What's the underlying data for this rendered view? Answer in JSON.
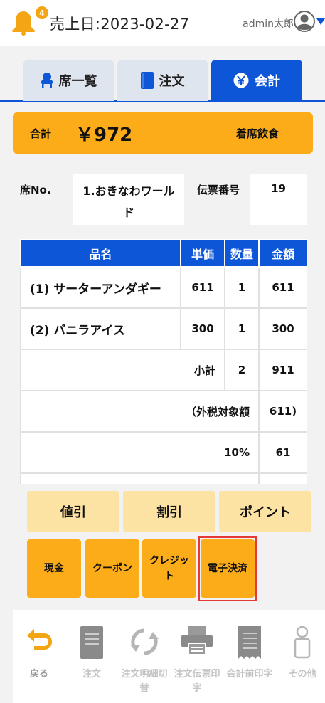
{
  "header": {
    "notification_count": "4",
    "sales_date": "売上日:2023-02-27",
    "user_name": "admin太郎"
  },
  "tabs": [
    {
      "label": "席一覧",
      "icon": "chair-icon",
      "active": false
    },
    {
      "label": "注文",
      "icon": "book-icon",
      "active": false
    },
    {
      "label": "会計",
      "icon": "yen-coin-icon",
      "active": true
    }
  ],
  "total": {
    "label": "合計",
    "amount": "￥972",
    "dine_type": "着席飲食"
  },
  "seat": {
    "label": "席No.",
    "value": "1.おきなわワールド",
    "slip_label": "伝票番号",
    "slip_value": "19"
  },
  "table": {
    "headers": [
      "品名",
      "単価",
      "数量",
      "金額"
    ],
    "items": [
      {
        "name": "(1) サーターアンダギー",
        "price": "611",
        "qty": "1",
        "amount": "611"
      },
      {
        "name": "(2) バニラアイス",
        "price": "300",
        "qty": "1",
        "amount": "300"
      }
    ],
    "subtotal": {
      "label": "小計",
      "qty": "2",
      "amount": "911"
    },
    "taxable": {
      "label": "（外税対象額",
      "amount": "611)"
    },
    "tax": {
      "label": "10%",
      "amount": "61"
    }
  },
  "discount_buttons": [
    "値引",
    "割引",
    "ポイント"
  ],
  "payment_buttons": [
    "現金",
    "クーポン",
    "クレジット",
    "電子決済"
  ],
  "bottom_nav": [
    {
      "label": "戻る",
      "icon": "return-arrow-icon"
    },
    {
      "label": "注文",
      "icon": "document-icon"
    },
    {
      "label": "注文明細切替",
      "icon": "refresh-icon"
    },
    {
      "label": "注文伝票印字",
      "icon": "printer-icon"
    },
    {
      "label": "会計前印字",
      "icon": "receipt-icon"
    },
    {
      "label": "その他",
      "icon": "person-icon"
    }
  ],
  "colors": {
    "accent": "#0d56d8",
    "orange": "#fbac18",
    "light_orange": "#fce3a3",
    "highlight": "#e53935"
  }
}
